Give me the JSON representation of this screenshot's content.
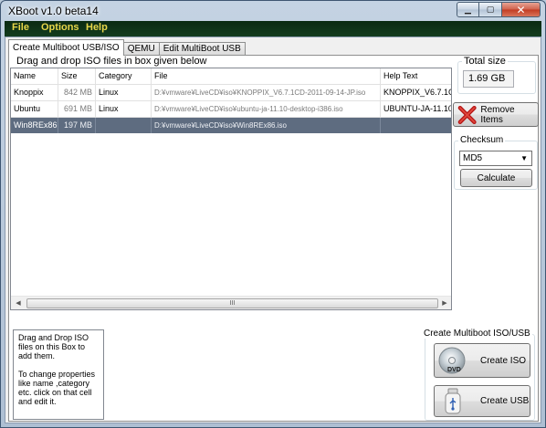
{
  "window": {
    "title": "XBoot v1.0 beta14",
    "controls": {
      "minimize": "▁",
      "maximize": "▢",
      "close": "✕"
    }
  },
  "menu": [
    "File",
    "Options",
    "Help"
  ],
  "tabs": [
    "Create Multiboot USB/ISO",
    "QEMU",
    "Edit MultiBoot USB"
  ],
  "files_group": {
    "title": "Drag and drop ISO files in box given below",
    "columns": [
      "Name",
      "Size",
      "Category",
      "File",
      "Help Text"
    ],
    "rows": [
      {
        "name": "Knoppix",
        "size": "842 MB",
        "category": "Linux",
        "file": "D:¥vmware¥LiveCD¥iso¥KNOPPIX_V6.7.1CD-2011-09-14-JP.iso",
        "help": "KNOPPIX_V6.7.1C",
        "selected": false
      },
      {
        "name": "Ubuntu",
        "size": "691 MB",
        "category": "Linux",
        "file": "D:¥vmware¥LiveCD¥iso¥ubuntu-ja-11.10-desktop-i386.iso",
        "help": "UBUNTU-JA-11.10",
        "selected": false
      },
      {
        "name": "Win8REx86",
        "size": "197 MB",
        "category": "",
        "file": "D:¥vmware¥LiveCD¥iso¥Win8REx86.iso",
        "help": "",
        "selected": true
      }
    ],
    "scroll_left": "◀",
    "scroll_right": "▶",
    "scroll_grip": "III"
  },
  "total_size": {
    "label": "Total size",
    "value": "1.69 GB"
  },
  "remove_button": "Remove Items",
  "checksum": {
    "label": "Checksum",
    "selected": "MD5",
    "calculate": "Calculate"
  },
  "info_text": "Drag and Drop ISO files on this Box to add them.\n\nTo change properties like name ,category etc. click on that cell and edit it.",
  "create_group": {
    "title": "Create Multiboot ISO/USB",
    "iso_button": "Create ISO",
    "usb_button": "Create USB",
    "dvd_text": "DVD"
  }
}
